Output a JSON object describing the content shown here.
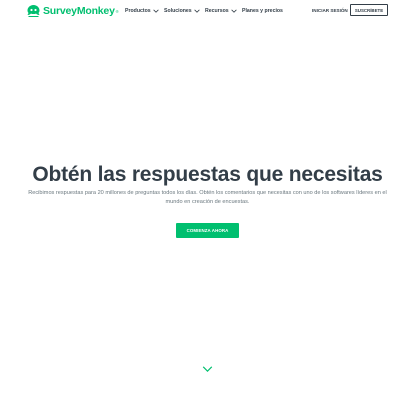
{
  "brand": {
    "name": "SurveyMonkey",
    "trademark": "®",
    "color": "#00bf6f"
  },
  "nav": {
    "items": [
      {
        "label": "Productos",
        "has_dropdown": true
      },
      {
        "label": "Soluciones",
        "has_dropdown": true
      },
      {
        "label": "Recursos",
        "has_dropdown": true
      },
      {
        "label": "Planes y precios",
        "has_dropdown": false
      }
    ],
    "login_label": "INICIAR SESIÓN",
    "signup_label": "SUSCRÍBETE"
  },
  "hero": {
    "title": "Obtén las respuestas que necesitas",
    "subtitle": "Recibimos respuestas para 20 millones de preguntas todos los días. Obtén los comentarios que necesitas con uno de los softwares líderes en el mundo en creación de encuestas.",
    "cta_label": "COMIENZA AHORA"
  },
  "colors": {
    "text_dark": "#333e48",
    "text_muted": "#6b787f",
    "accent": "#00bf6f"
  },
  "icons": {
    "logo": "surveymonkey-logo-icon",
    "dropdown": "chevron-down-icon",
    "scroll": "chevron-down-icon"
  }
}
